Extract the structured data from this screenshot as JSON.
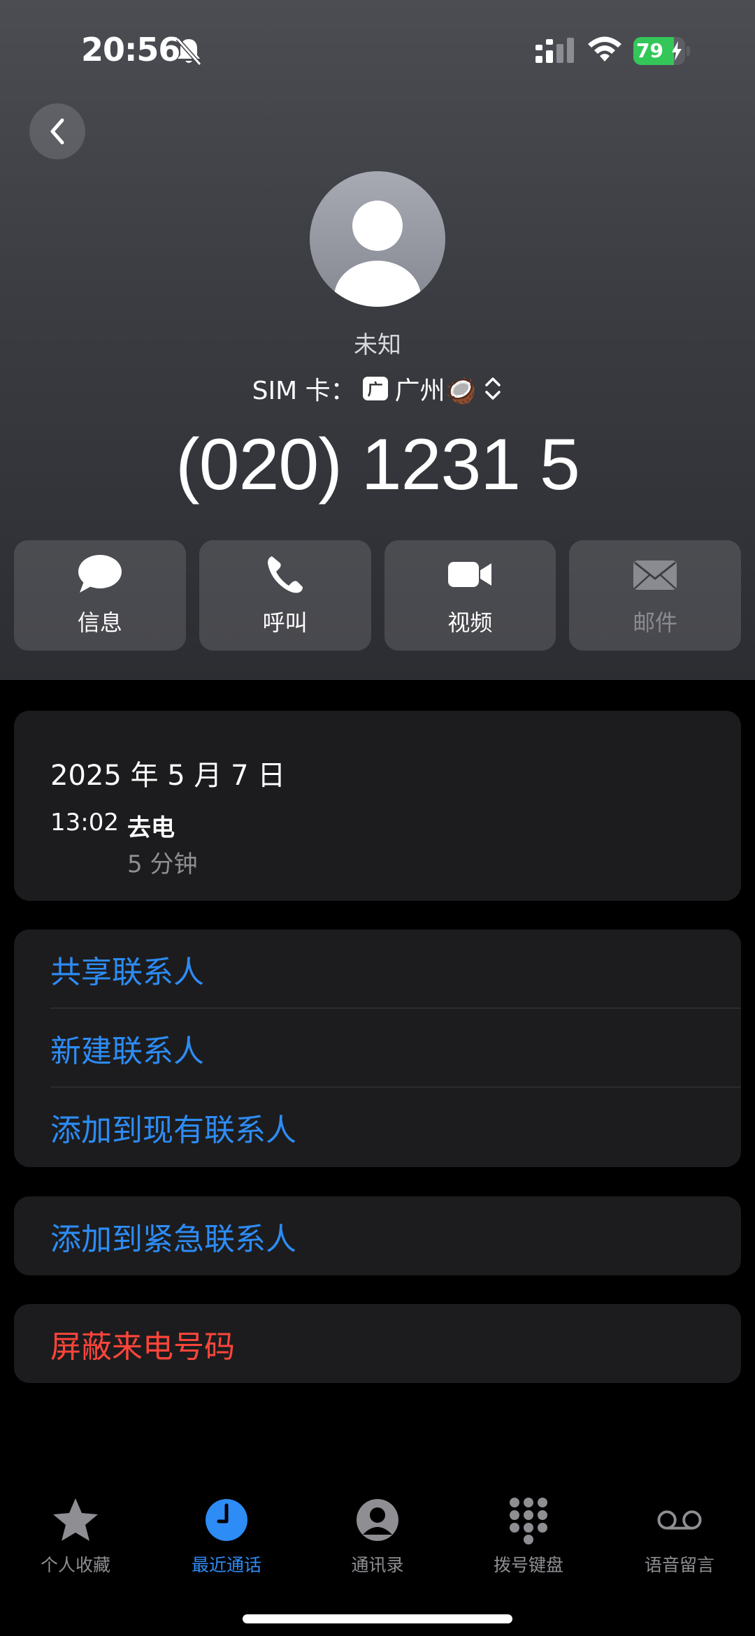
{
  "status_bar": {
    "time": "20:56",
    "battery_percent": "79",
    "battery_level": 0.79,
    "battery_color": "#33c759",
    "icons": [
      "bell-slash-icon",
      "signal-icon",
      "wifi-icon",
      "battery-charging-icon"
    ]
  },
  "contact": {
    "name": "未知",
    "sim_prefix": "SIM 卡：",
    "sim_badge": "广",
    "sim_name": "广州🥥",
    "phone_number": "(020) 1231 5"
  },
  "actions": [
    {
      "label": "信息",
      "icon": "message-bubble-icon",
      "enabled": true
    },
    {
      "label": "呼叫",
      "icon": "phone-icon",
      "enabled": true
    },
    {
      "label": "视频",
      "icon": "video-camera-icon",
      "enabled": true
    },
    {
      "label": "邮件",
      "icon": "envelope-icon",
      "enabled": false
    }
  ],
  "call_log": {
    "date": "2025 年 5 月 7 日",
    "time": "13:02",
    "type": "去电",
    "duration": "5 分钟"
  },
  "contact_options": [
    "共享联系人",
    "新建联系人",
    "添加到现有联系人"
  ],
  "emergency_option": "添加到紧急联系人",
  "block_option": "屏蔽来电号码",
  "tabs": [
    {
      "label": "个人收藏",
      "icon": "star-icon",
      "active": false
    },
    {
      "label": "最近通话",
      "icon": "clock-icon",
      "active": true
    },
    {
      "label": "通讯录",
      "icon": "person-circle-icon",
      "active": false
    },
    {
      "label": "拨号键盘",
      "icon": "keypad-icon",
      "active": false
    },
    {
      "label": "语音留言",
      "icon": "voicemail-icon",
      "active": false
    }
  ],
  "colors": {
    "accent_blue": "#2d8cf5",
    "destructive_red": "#ff453a"
  }
}
